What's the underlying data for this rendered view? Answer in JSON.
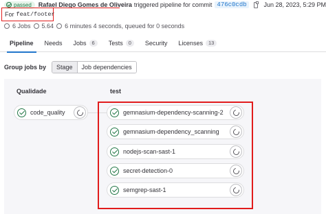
{
  "header": {
    "status": "passed",
    "author": "Rafael Diego Gomes de Oliveira",
    "action_text": "triggered pipeline for commit",
    "commit_sha": "476c0cdb",
    "date": "Jun 28, 2023, 5:29 PM"
  },
  "branch": {
    "prefix": "For",
    "name": "feat/footer"
  },
  "meta": {
    "jobs": "6 Jobs",
    "version": "5.64",
    "duration": "6 minutes 4 seconds, queued for 0 seconds"
  },
  "tabs": [
    {
      "label": "Pipeline",
      "count": "",
      "active": true
    },
    {
      "label": "Needs",
      "count": ""
    },
    {
      "label": "Jobs",
      "count": "6"
    },
    {
      "label": "Tests",
      "count": "0"
    },
    {
      "label": "Security",
      "count": ""
    },
    {
      "label": "Licenses",
      "count": "13"
    }
  ],
  "group_by": {
    "label": "Group jobs by",
    "options": [
      "Stage",
      "Job dependencies"
    ],
    "selected": "Stage"
  },
  "stages": [
    {
      "title": "Qualidade",
      "jobs": [
        "code_quality"
      ]
    },
    {
      "title": "test",
      "jobs": [
        "gemnasium-dependency-scanning-2",
        "gemnasium-dependency_scanning",
        "nodejs-scan-sast-1",
        "secret-detection-0",
        "semgrep-sast-1"
      ]
    }
  ],
  "colors": {
    "success": "#217645",
    "accent": "#1f75cb",
    "highlight": "#e11b1b"
  },
  "icons": {
    "status": "check-circle-icon",
    "retry": "retry-icon",
    "copy": "copy-icon"
  }
}
